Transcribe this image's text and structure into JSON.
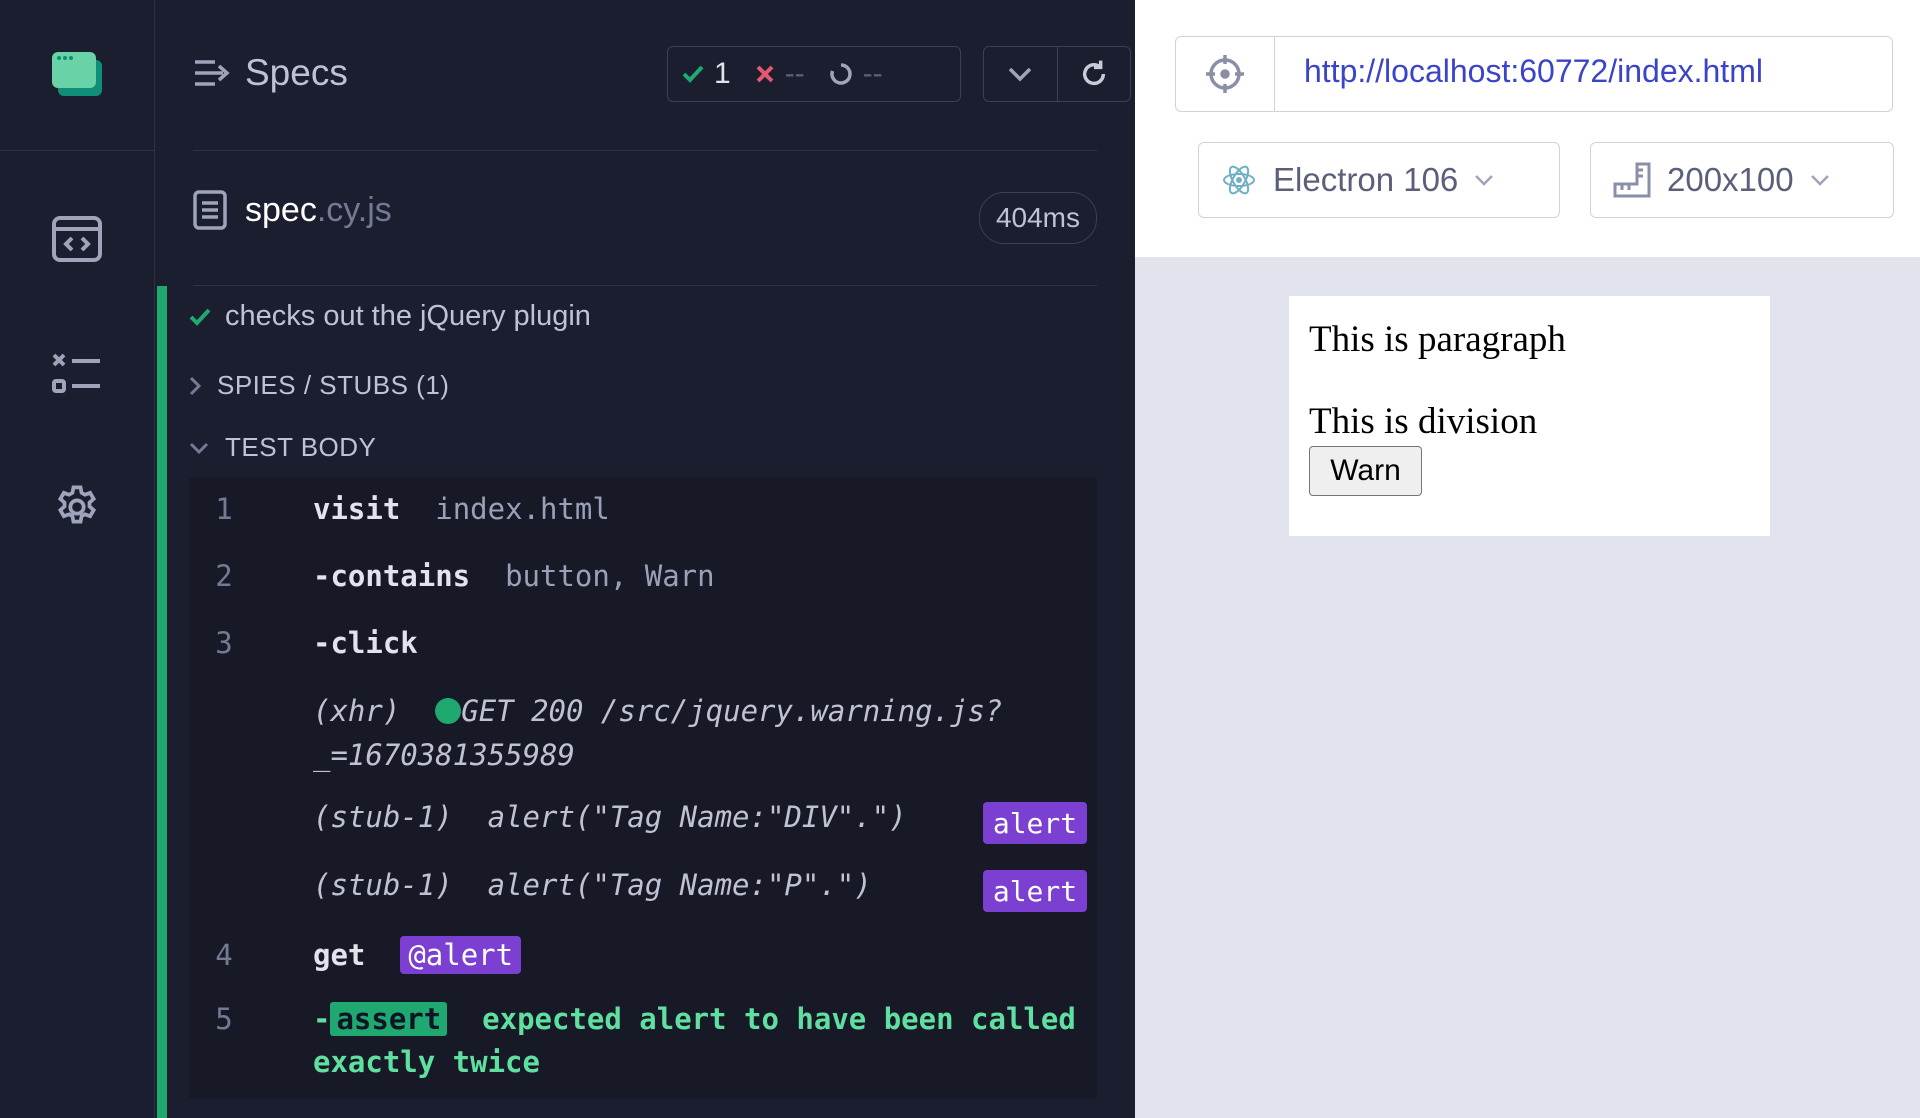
{
  "reporter": {
    "title": "Specs",
    "stats": {
      "passed": "1",
      "failed": "--",
      "pending": "--"
    },
    "file": {
      "name": "spec",
      "ext": ".cy.js",
      "duration": "404ms"
    },
    "test": {
      "title": "checks out the jQuery plugin",
      "spies_label": "SPIES / STUBS (1)",
      "body_label": "TEST BODY"
    },
    "commands": {
      "c1": {
        "num": "1",
        "name": "visit",
        "arg": "index.html"
      },
      "c2": {
        "num": "2",
        "name": "-contains",
        "arg": "button, Warn"
      },
      "c3": {
        "num": "3",
        "name": "-click"
      },
      "xhr": {
        "label": "(xhr)",
        "text": "GET 200 /src/jquery.warning.js?",
        "text2": "_=1670381355989"
      },
      "stub1": {
        "label": "(stub-1)",
        "text": "alert(\"Tag Name:\"DIV\".\")",
        "tag": "alert"
      },
      "stub2": {
        "label": "(stub-1)",
        "text": "alert(\"Tag Name:\"P\".\")",
        "tag": "alert"
      },
      "c4": {
        "num": "4",
        "name": "get",
        "alias": "@alert"
      },
      "c5": {
        "num": "5",
        "dash": "-",
        "name": "assert",
        "text": "expected alert to have been called",
        "text2": "exactly twice"
      }
    }
  },
  "preview": {
    "url": "http://localhost:60772/index.html",
    "browser": "Electron 106",
    "viewport": "200x100",
    "aut": {
      "paragraph": "This is paragraph",
      "division": "This is division",
      "button": "Warn"
    }
  },
  "colors": {
    "pass": "#1fa971",
    "fail": "#e45770",
    "alias": "#7b3fd1",
    "link": "#3b44c9"
  }
}
